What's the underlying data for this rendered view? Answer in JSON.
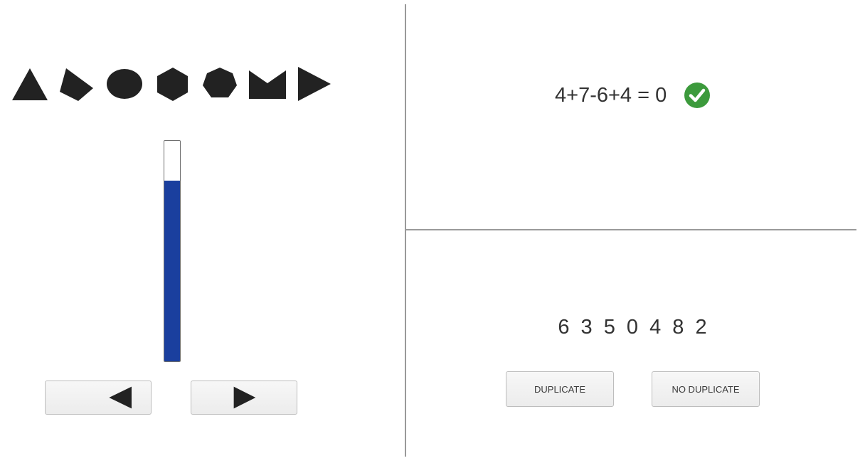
{
  "left_panel": {
    "shapes": [
      {
        "name": "triangle-icon",
        "color": "#222222"
      },
      {
        "name": "quadrilateral-icon",
        "color": "#222222"
      },
      {
        "name": "ellipse-icon",
        "color": "#222222"
      },
      {
        "name": "hexagon-icon",
        "color": "#222222"
      },
      {
        "name": "heptagon-icon",
        "color": "#222222"
      },
      {
        "name": "notched-rectangle-icon",
        "color": "#222222"
      },
      {
        "name": "right-triangle-arrow-icon",
        "color": "#222222"
      }
    ],
    "gauge": {
      "level_fraction": 0.82,
      "fill_color": "#1a3f9e"
    },
    "nav_buttons": {
      "left_icon": "left-arrow-icon",
      "right_icon": "right-arrow-icon"
    }
  },
  "top_right_panel": {
    "equation": "4+7-6+4 = 0",
    "status_icon": "check-circle-icon",
    "status_color": "#3c9a3c"
  },
  "bottom_right_panel": {
    "digits": "6 3 5 0 4 8 2",
    "buttons": {
      "duplicate_label": "DUPLICATE",
      "no_duplicate_label": "NO DUPLICATE"
    }
  }
}
